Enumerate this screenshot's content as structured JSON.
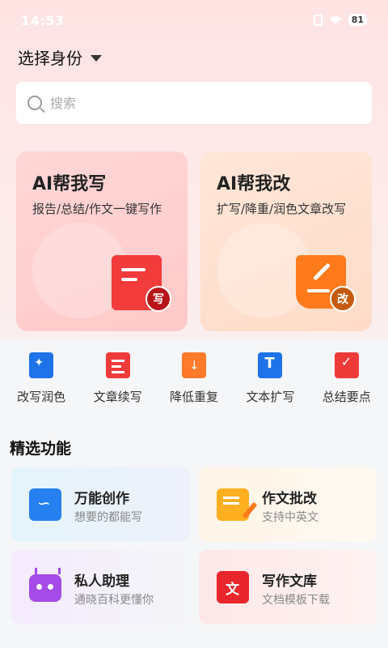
{
  "status_bar": {
    "time": "14:53",
    "battery": "81"
  },
  "identity": {
    "label": "选择身份"
  },
  "search": {
    "placeholder": "搜索"
  },
  "cards": [
    {
      "title": "AI帮我写",
      "desc": "报告/总结/作文一键写作",
      "badge": "写"
    },
    {
      "title": "AI帮我改",
      "desc": "扩写/降重/润色文章改写",
      "badge": "改"
    }
  ],
  "tools": [
    {
      "label": "改写润色",
      "icon": "magic-wand-icon"
    },
    {
      "label": "文章续写",
      "icon": "doc-continue-icon"
    },
    {
      "label": "降低重复",
      "icon": "reduce-duplicate-icon"
    },
    {
      "label": "文本扩写",
      "icon": "text-expand-icon"
    },
    {
      "label": "总结要点",
      "icon": "checklist-icon"
    }
  ],
  "section": {
    "title": "精选功能"
  },
  "features": [
    {
      "title": "万能创作",
      "sub": "想要的都能写",
      "icon": "book-icon"
    },
    {
      "title": "作文批改",
      "sub": "支持中英文",
      "icon": "note-edit-icon"
    },
    {
      "title": "私人助理",
      "sub": "通晓百科更懂你",
      "icon": "robot-icon"
    },
    {
      "title": "写作文库",
      "sub": "文档模板下载",
      "icon": "library-icon"
    }
  ],
  "colors": {
    "accent_red": "#ef3a3a",
    "accent_orange": "#ff7a1a",
    "accent_blue": "#1e73e8"
  }
}
